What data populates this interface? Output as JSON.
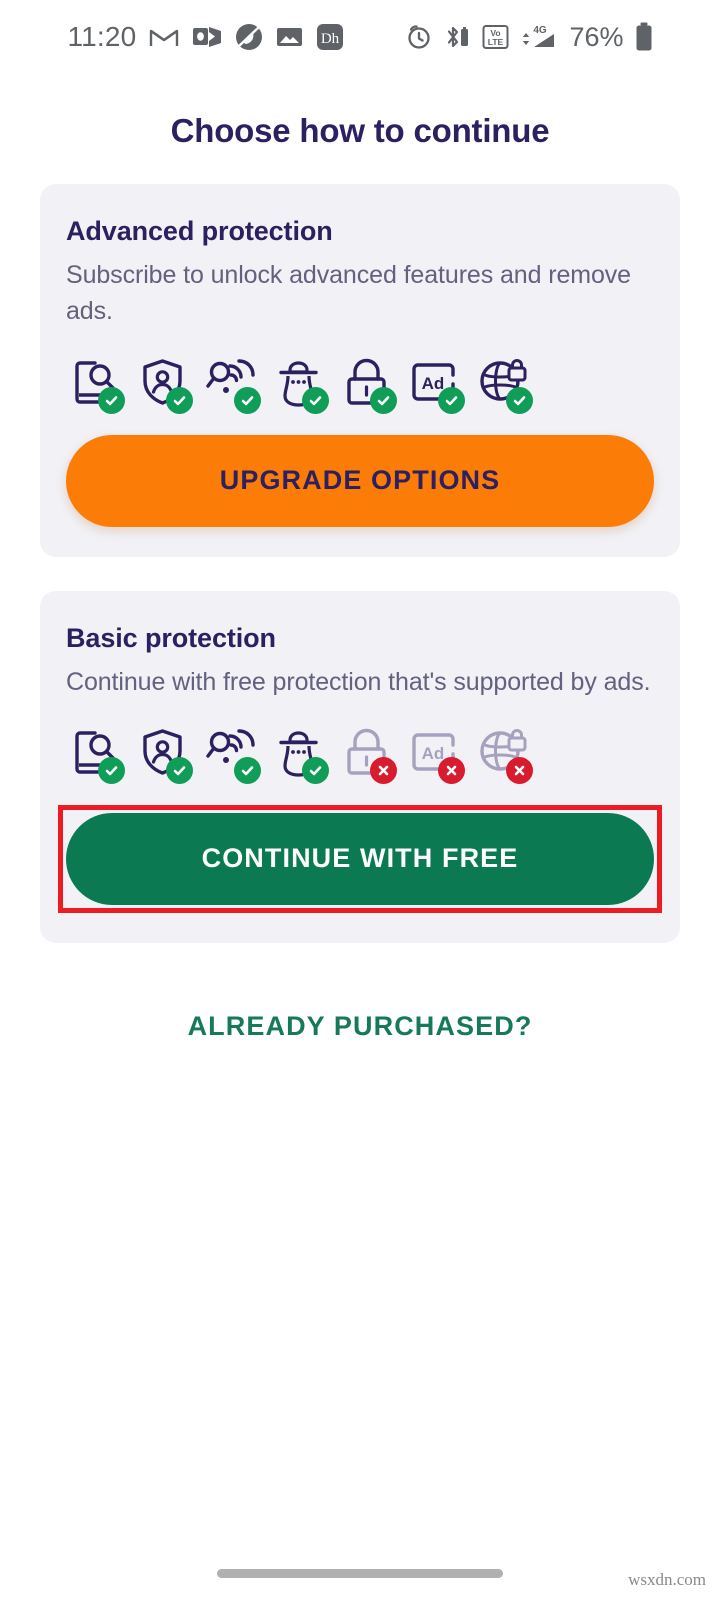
{
  "status_bar": {
    "time": "11:20",
    "battery_percent": "76%",
    "left_icons": [
      "gmail-icon",
      "outlook-icon",
      "adblock-app-icon",
      "gallery-icon",
      "dh-app-icon"
    ],
    "right_icons": [
      "alarm-icon",
      "bluetooth-icon",
      "volte-icon",
      "signal-4g-icon",
      "battery-icon"
    ],
    "network_label": "4G",
    "volte_label_top": "Vo",
    "volte_label_bottom": "LTE"
  },
  "page": {
    "title": "Choose how to continue"
  },
  "colors": {
    "brand_navy": "#2d2060",
    "upgrade_orange": "#fb7d07",
    "free_green": "#0b7a53",
    "link_green": "#15795a",
    "check_green": "#0f9d58",
    "cross_red": "#d81b2e",
    "highlight_red": "#ed1c24",
    "card_bg": "#f1f1f6",
    "body_text": "#63617e",
    "disabled_icon": "#a6a2bd"
  },
  "advanced_card": {
    "title": "Advanced protection",
    "description": "Subscribe to unlock advanced features and remove ads.",
    "features": [
      {
        "name": "device-scan-icon",
        "enabled": true
      },
      {
        "name": "identity-shield-icon",
        "enabled": true
      },
      {
        "name": "wifi-scan-icon",
        "enabled": true
      },
      {
        "name": "anti-spy-icon",
        "enabled": true
      },
      {
        "name": "app-lock-icon",
        "enabled": true
      },
      {
        "name": "ad-block-icon",
        "enabled": true
      },
      {
        "name": "vpn-globe-lock-icon",
        "enabled": true
      }
    ],
    "button_label": "UPGRADE OPTIONS"
  },
  "basic_card": {
    "title": "Basic protection",
    "description": "Continue with free protection that's supported by ads.",
    "features": [
      {
        "name": "device-scan-icon",
        "enabled": true
      },
      {
        "name": "identity-shield-icon",
        "enabled": true
      },
      {
        "name": "wifi-scan-icon",
        "enabled": true
      },
      {
        "name": "anti-spy-icon",
        "enabled": true
      },
      {
        "name": "app-lock-icon",
        "enabled": false
      },
      {
        "name": "ad-block-icon",
        "enabled": false
      },
      {
        "name": "vpn-globe-lock-icon",
        "enabled": false
      }
    ],
    "button_label": "CONTINUE WITH FREE",
    "button_highlighted": true
  },
  "footer": {
    "already_purchased_label": "ALREADY PURCHASED?"
  },
  "watermark": {
    "text": "wsxdn.com"
  }
}
